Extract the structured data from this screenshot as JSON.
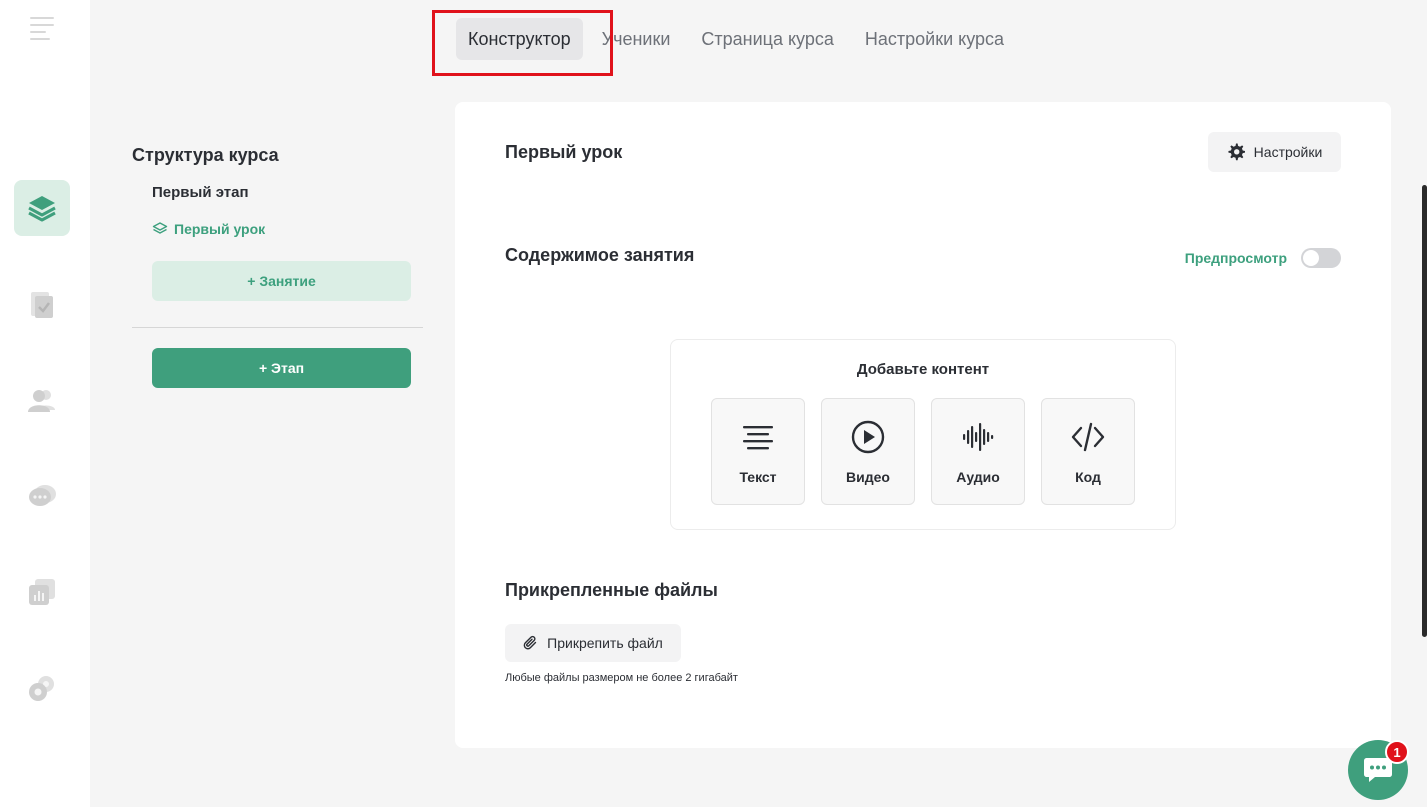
{
  "tabs": [
    {
      "label": "Конструктор",
      "active": true
    },
    {
      "label": "Ученики",
      "active": false
    },
    {
      "label": "Страница курса",
      "active": false
    },
    {
      "label": "Настройки курса",
      "active": false
    }
  ],
  "sidebar": {
    "items": [
      {
        "icon": "layers-icon",
        "active": true
      },
      {
        "icon": "document-check-icon",
        "active": false
      },
      {
        "icon": "users-icon",
        "active": false
      },
      {
        "icon": "chat-bubbles-icon",
        "active": false
      },
      {
        "icon": "analytics-icon",
        "active": false
      },
      {
        "icon": "gears-icon",
        "active": false
      }
    ]
  },
  "structure": {
    "title": "Структура курса",
    "stage_name": "Первый этап",
    "lesson_name": "Первый урок",
    "add_lesson_label": "+ Занятие",
    "add_stage_label": "+ Этап"
  },
  "lesson": {
    "title": "Первый урок",
    "settings_label": "Настройки",
    "content_title": "Содержимое занятия",
    "preview_label": "Предпросмотр",
    "preview_enabled": false
  },
  "add_content": {
    "title": "Добавьте контент",
    "items": [
      {
        "label": "Текст",
        "icon": "text-lines-icon"
      },
      {
        "label": "Видео",
        "icon": "play-circle-icon"
      },
      {
        "label": "Аудио",
        "icon": "audio-wave-icon"
      },
      {
        "label": "Код",
        "icon": "code-icon"
      }
    ]
  },
  "files": {
    "title": "Прикрепленные файлы",
    "attach_label": "Прикрепить файл",
    "note": "Любые файлы размером не более 2 гигабайт"
  },
  "chat": {
    "badge_count": "1"
  },
  "colors": {
    "accent": "#3f9f7d",
    "accent_light": "#dbeee5",
    "highlight": "#e0121b"
  }
}
